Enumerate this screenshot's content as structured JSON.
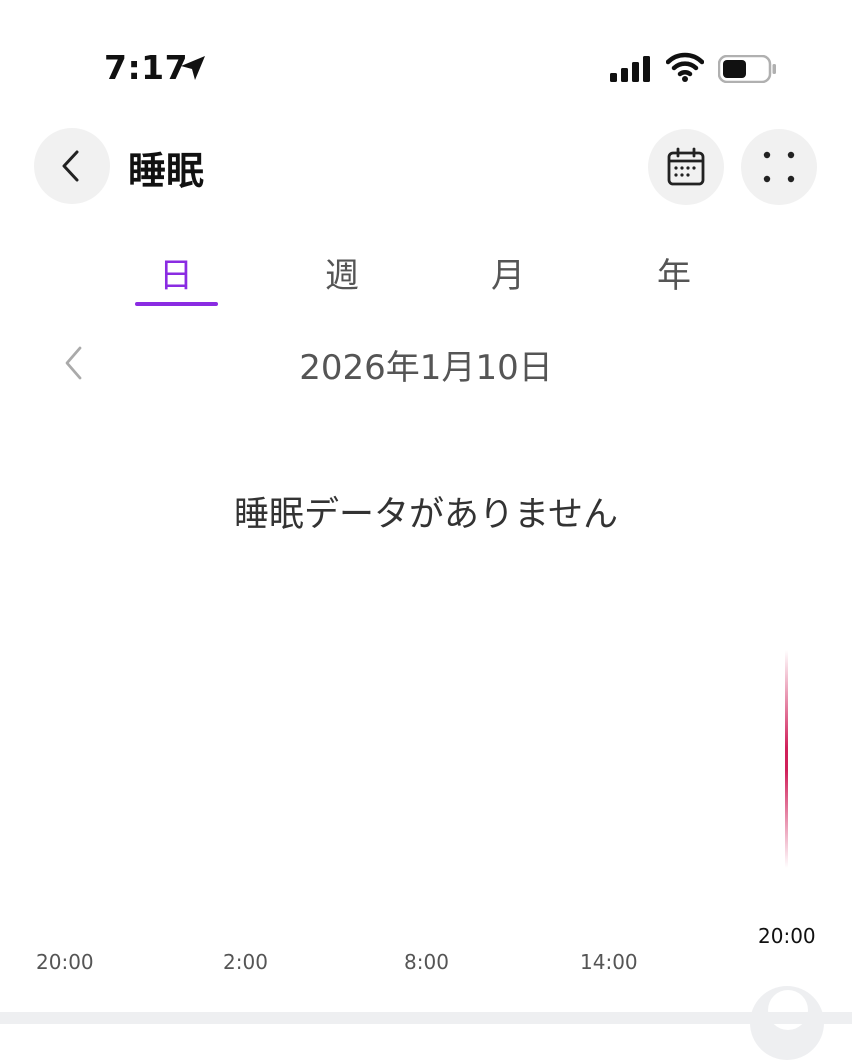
{
  "status_bar": {
    "time": "7:17"
  },
  "header": {
    "title": "睡眠"
  },
  "tabs": [
    {
      "label": "日",
      "active": true
    },
    {
      "label": "週",
      "active": false
    },
    {
      "label": "月",
      "active": false
    },
    {
      "label": "年",
      "active": false
    }
  ],
  "date_nav": {
    "date": "2026年1月10日"
  },
  "empty_message": "睡眠データがありません",
  "chart": {
    "x_ticks": [
      "20:00",
      "2:00",
      "8:00",
      "14:00"
    ],
    "end_marker_label": "20:00"
  },
  "colors": {
    "accent": "#8a2be2",
    "marker": "#d0205a"
  }
}
